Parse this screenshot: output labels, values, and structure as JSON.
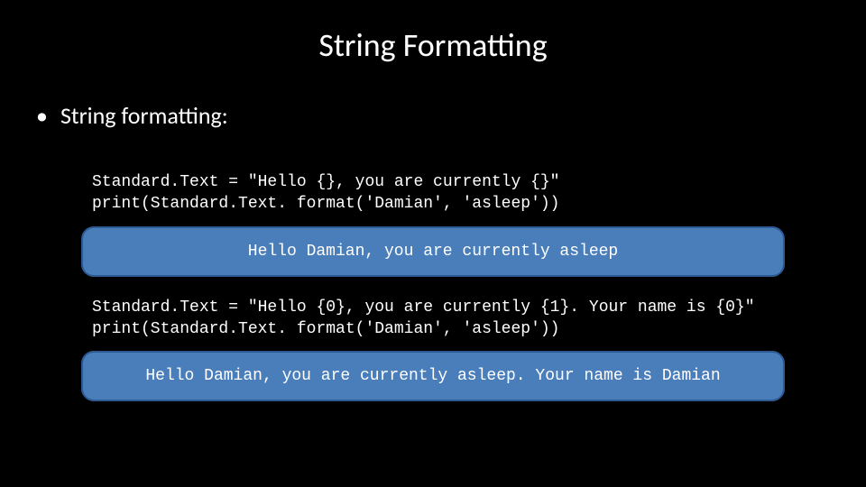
{
  "slide": {
    "title": "String Formatting",
    "bullet": "String formatting:",
    "example1": {
      "code_line1": "Standard.Text = \"Hello {}, you are currently {}\"",
      "code_line2": "print(Standard.Text. format('Damian', 'asleep'))",
      "output": "Hello Damian, you are currently asleep"
    },
    "example2": {
      "code_line1": "Standard.Text = \"Hello {0}, you are currently {1}. Your name is {0}\"",
      "code_line2": "print(Standard.Text. format('Damian', 'asleep'))",
      "output": "Hello Damian, you are currently asleep. Your name is Damian"
    }
  }
}
